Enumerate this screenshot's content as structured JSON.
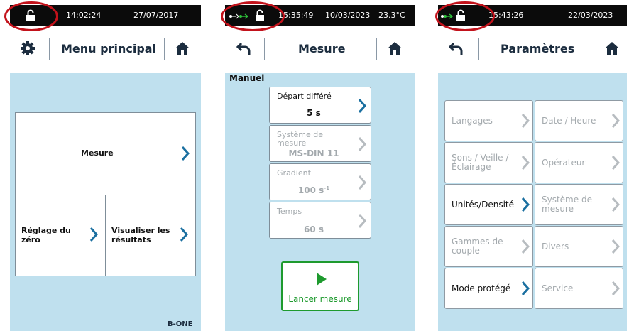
{
  "screens": [
    {
      "status": {
        "time": "14:02:24",
        "date": "27/07/2017"
      },
      "title": "Menu principal",
      "tiles": [
        "Mesure",
        "Réglage du zéro",
        "Visualiser les résultats"
      ],
      "footer": "B-ONE"
    },
    {
      "status": {
        "time": "15:35:49",
        "date": "10/03/2023",
        "temp": "23.3°C"
      },
      "title": "Mesure",
      "section": "Manuel",
      "items": [
        {
          "label": "Départ différé",
          "value": "5 s"
        },
        {
          "label": "Système de mesure",
          "value": "MS-DIN 11"
        },
        {
          "label": "Gradient",
          "value": "100 s",
          "sup": "-1"
        },
        {
          "label": "Temps",
          "value": "60 s"
        }
      ],
      "launch": "Lancer mesure"
    },
    {
      "status": {
        "time": "15:43:26",
        "date": "22/03/2023"
      },
      "title": "Paramètres",
      "items": [
        {
          "label": "Langages"
        },
        {
          "label": "Date / Heure"
        },
        {
          "label": "Sons / Veille / Éclairage"
        },
        {
          "label": "Opérateur"
        },
        {
          "label": "Unités/Densité"
        },
        {
          "label": "Système de mesure"
        },
        {
          "label": "Gammes de couple"
        },
        {
          "label": "Divers"
        },
        {
          "label": "Mode protégé"
        },
        {
          "label": "Service"
        }
      ]
    }
  ],
  "colors": {
    "accent": "#1a6fa0",
    "launch": "#1e9a2e",
    "annotation": "#c2121b"
  },
  "icons": [
    "lock-icon",
    "usb-icon",
    "gear-icon",
    "home-icon",
    "back-icon",
    "chevron-right-icon",
    "play-icon"
  ]
}
